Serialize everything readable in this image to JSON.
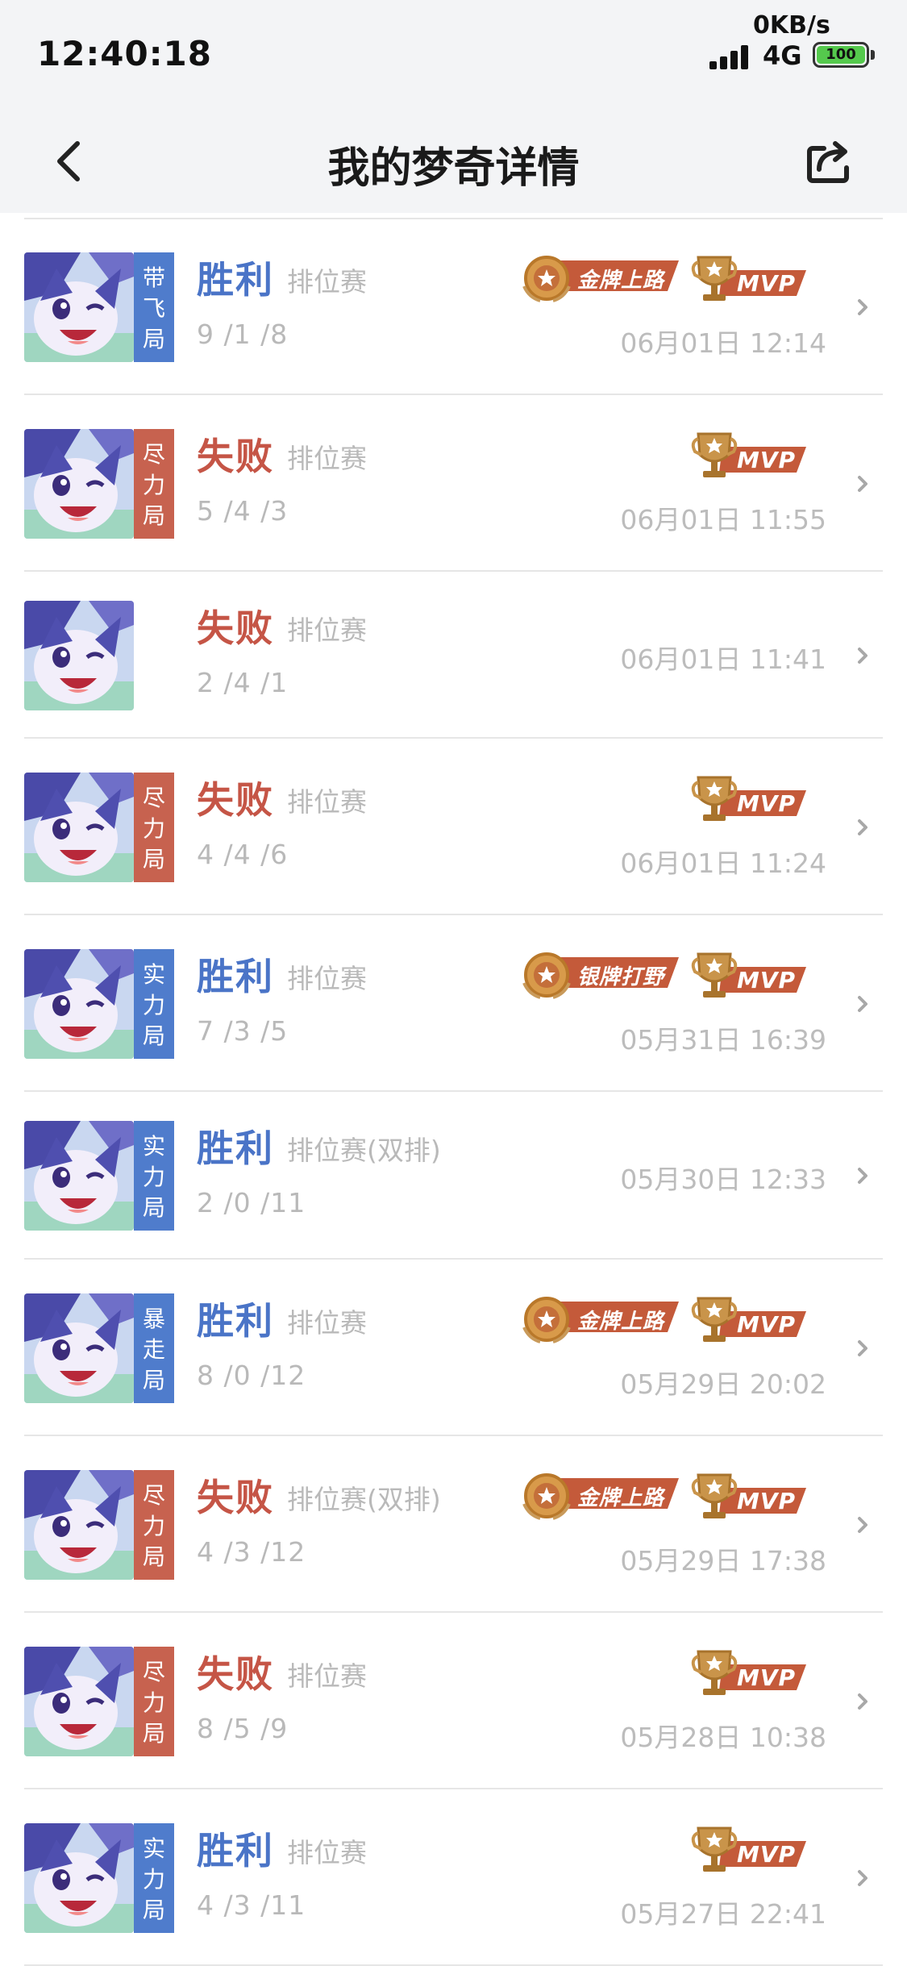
{
  "status_bar": {
    "time": "12:40:18",
    "net_speed": "0KB/s",
    "network": "4G",
    "battery": "100"
  },
  "nav": {
    "title": "我的梦奇详情"
  },
  "badges": {
    "mvp": "MVP"
  },
  "matches": [
    {
      "tag": [
        "带",
        "飞",
        "局"
      ],
      "tag_color": "#4f7ccc",
      "result": "胜利",
      "outcome": "win",
      "mode": "排位赛",
      "kda": "9 /1 /8",
      "date": "06月01日 12:14",
      "medal": "金牌上路",
      "mvp": true
    },
    {
      "tag": [
        "尽",
        "力",
        "局"
      ],
      "tag_color": "#c7624f",
      "result": "失败",
      "outcome": "lose",
      "mode": "排位赛",
      "kda": "5 /4 /3",
      "date": "06月01日 11:55",
      "medal": "",
      "mvp": true
    },
    {
      "tag": [],
      "tag_color": "",
      "result": "失败",
      "outcome": "lose",
      "mode": "排位赛",
      "kda": "2 /4 /1",
      "date": "06月01日 11:41",
      "medal": "",
      "mvp": false
    },
    {
      "tag": [
        "尽",
        "力",
        "局"
      ],
      "tag_color": "#c7624f",
      "result": "失败",
      "outcome": "lose",
      "mode": "排位赛",
      "kda": "4 /4 /6",
      "date": "06月01日 11:24",
      "medal": "",
      "mvp": true
    },
    {
      "tag": [
        "实",
        "力",
        "局"
      ],
      "tag_color": "#4f7ccc",
      "result": "胜利",
      "outcome": "win",
      "mode": "排位赛",
      "kda": "7 /3 /5",
      "date": "05月31日 16:39",
      "medal": "银牌打野",
      "mvp": true
    },
    {
      "tag": [
        "实",
        "力",
        "局"
      ],
      "tag_color": "#4f7ccc",
      "result": "胜利",
      "outcome": "win",
      "mode": "排位赛(双排)",
      "kda": "2 /0 /11",
      "date": "05月30日 12:33",
      "medal": "",
      "mvp": false
    },
    {
      "tag": [
        "暴",
        "走",
        "局"
      ],
      "tag_color": "#4f7ccc",
      "result": "胜利",
      "outcome": "win",
      "mode": "排位赛",
      "kda": "8 /0 /12",
      "date": "05月29日 20:02",
      "medal": "金牌上路",
      "mvp": true
    },
    {
      "tag": [
        "尽",
        "力",
        "局"
      ],
      "tag_color": "#c7624f",
      "result": "失败",
      "outcome": "lose",
      "mode": "排位赛(双排)",
      "kda": "4 /3 /12",
      "date": "05月29日 17:38",
      "medal": "金牌上路",
      "mvp": true
    },
    {
      "tag": [
        "尽",
        "力",
        "局"
      ],
      "tag_color": "#c7624f",
      "result": "失败",
      "outcome": "lose",
      "mode": "排位赛",
      "kda": "8 /5 /9",
      "date": "05月28日 10:38",
      "medal": "",
      "mvp": true
    },
    {
      "tag": [
        "实",
        "力",
        "局"
      ],
      "tag_color": "#4f7ccc",
      "result": "胜利",
      "outcome": "win",
      "mode": "排位赛",
      "kda": "4 /3 /11",
      "date": "05月27日 22:41",
      "medal": "",
      "mvp": true
    }
  ]
}
